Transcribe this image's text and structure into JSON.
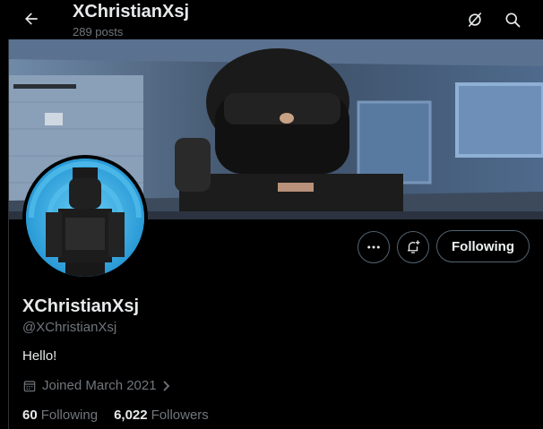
{
  "header": {
    "name": "XChristianXsj",
    "posts_count": "289 posts",
    "icons": {
      "back": "arrow-left-icon",
      "grok": "grok-icon",
      "search": "search-icon"
    }
  },
  "banner": {
    "description_icon": "banner-image"
  },
  "profile": {
    "display_name": "XChristianXsj",
    "handle": "@XChristianXsj",
    "bio": "Hello!",
    "joined": "Joined March 2021",
    "following_count": "60",
    "following_label": "Following",
    "followers_count": "6,022",
    "followers_label": "Followers"
  },
  "actions": {
    "more_icon": "more-icon",
    "notify_icon": "bell-plus-icon",
    "follow_button_label": "Following"
  },
  "colors": {
    "background": "#000000",
    "text_primary": "#e7e9ea",
    "text_secondary": "#71767b",
    "border": "#536471",
    "avatar_bg": "#2d9fdc"
  }
}
